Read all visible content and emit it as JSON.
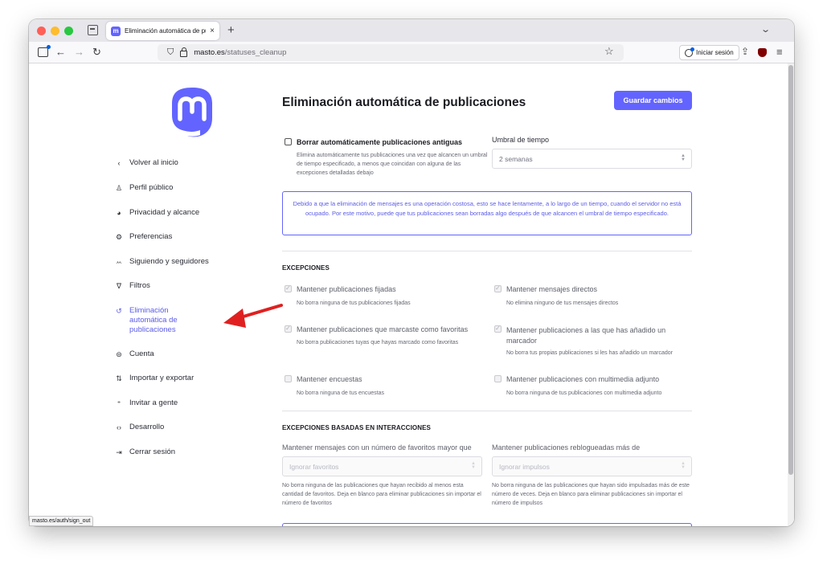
{
  "browser": {
    "tab_title": "Eliminación automática de publi",
    "tab_close": "×",
    "new_tab": "+",
    "url_host": "masto.es",
    "url_path": "/statuses_cleanup",
    "signin_label": "Iniciar sesión",
    "status_url": "masto.es/auth/sign_out"
  },
  "sidebar": {
    "items": [
      {
        "icon": "‹",
        "label": "Volver al inicio"
      },
      {
        "icon": "♙",
        "label": "Perfil público"
      },
      {
        "icon": "◕",
        "label": "Privacidad y alcance"
      },
      {
        "icon": "⚙",
        "label": "Preferencias"
      },
      {
        "icon": "ꕀ",
        "label": "Siguiendo y seguidores"
      },
      {
        "icon": "∇",
        "label": "Filtros"
      },
      {
        "icon": "↺",
        "label": "Eliminación automática de publicaciones"
      },
      {
        "icon": "⊜",
        "label": "Cuenta"
      },
      {
        "icon": "⇅",
        "label": "Importar y exportar"
      },
      {
        "icon": "⁺",
        "label": "Invitar a gente"
      },
      {
        "icon": "‹›",
        "label": "Desarrollo"
      },
      {
        "icon": "⇥",
        "label": "Cerrar sesión"
      }
    ]
  },
  "main": {
    "title": "Eliminación automática de publicaciones",
    "save_label": "Guardar cambios",
    "auto_delete": {
      "label": "Borrar automáticamente publicaciones antiguas",
      "hint": "Elimina automáticamente tus publicaciones una vez que alcancen un umbral de tiempo especificado, a menos que coincidan con alguna de las excepciones detalladas debajo"
    },
    "threshold": {
      "label": "Umbral de tiempo",
      "value": "2 semanas"
    },
    "info_text": "Debido a que la eliminación de mensajes es una operación costosa, esto se hace lentamente, a lo largo de un tiempo, cuando el servidor no está ocupado. Por este motivo, puede que tus publicaciones sean borradas algo después de que alcancen el umbral de tiempo especificado.",
    "exceptions_heading": "EXCEPCIONES",
    "exceptions": [
      {
        "label": "Mantener publicaciones fijadas",
        "hint": "No borra ninguna de tus publicaciones fijadas",
        "checked": true
      },
      {
        "label": "Mantener mensajes directos",
        "hint": "No elimina ninguno de tus mensajes directos",
        "checked": true
      },
      {
        "label": "Mantener publicaciones que marcaste como favoritas",
        "hint": "No borra publicaciones tuyas que hayas marcado como favoritas",
        "checked": true
      },
      {
        "label": "Mantener publicaciones a las que has añadido un marcador",
        "hint": "No borra tus propias publicaciones si les has añadido un marcador",
        "checked": true
      },
      {
        "label": "Mantener encuestas",
        "hint": "No borra ninguna de tus encuestas",
        "checked": false
      },
      {
        "label": "Mantener publicaciones con multimedia adjunto",
        "hint": "No borra ninguna de tus publicaciones con multimedia adjunto",
        "checked": false
      }
    ],
    "interaction_heading": "EXCEPCIONES BASADAS EN INTERACCIONES",
    "favs": {
      "label": "Mantener mensajes con un número de favoritos mayor que",
      "placeholder": "Ignorar favoritos",
      "hint": "No borra ninguna de las publicaciones que hayan recibido al menos esta cantidad de favoritos. Deja en blanco para eliminar publicaciones sin importar el número de favoritos"
    },
    "boosts": {
      "label": "Mantener publicaciones reblogueadas más de",
      "placeholder": "Ignorar impulsos",
      "hint": "No borra ninguna de las publicaciones que hayan sido impulsadas más de este número de veces. Deja en blanco para eliminar publicaciones sin importar el número de impulsos"
    }
  },
  "colors": {
    "accent": "#6364ff",
    "arrow": "#e02020"
  }
}
